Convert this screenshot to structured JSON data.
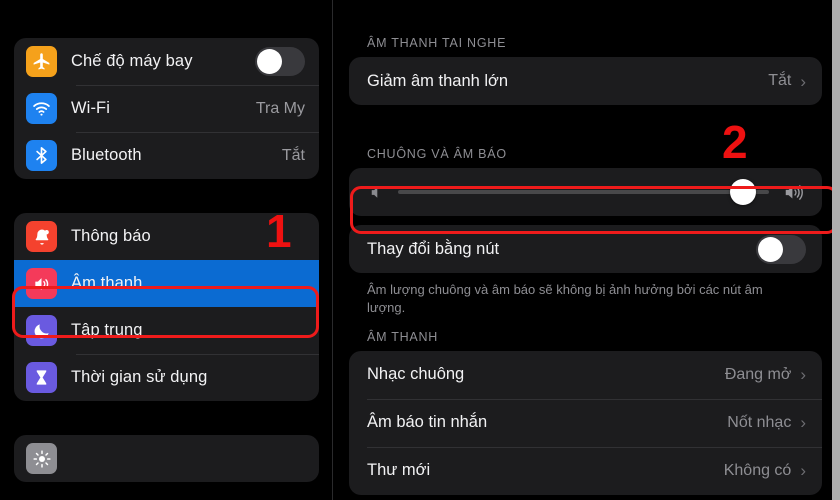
{
  "sidebar": {
    "group1": [
      {
        "label": "Chế độ máy bay",
        "icon": "airplane-icon",
        "icon_color": "#f5a11b",
        "control": "toggle",
        "toggle_on": false
      },
      {
        "label": "Wi-Fi",
        "icon": "wifi-icon",
        "icon_color": "#1e82f0",
        "control": "value",
        "value": "Tra My"
      },
      {
        "label": "Bluetooth",
        "icon": "bluetooth-icon",
        "icon_color": "#1e82f0",
        "control": "value",
        "value": "Tắt"
      }
    ],
    "group2": [
      {
        "label": "Thông báo",
        "icon": "bell-icon",
        "icon_color": "#f4422e",
        "selected": false
      },
      {
        "label": "Âm thanh",
        "icon": "speaker-icon",
        "icon_color": "#f43a5a",
        "selected": true
      },
      {
        "label": "Tập trung",
        "icon": "moon-icon",
        "icon_color": "#6a5ae0",
        "selected": false
      },
      {
        "label": "Thời gian sử dụng",
        "icon": "hourglass-icon",
        "icon_color": "#6a5ae0",
        "selected": false
      }
    ],
    "group3": [
      {
        "label": "",
        "icon": "brightness-icon",
        "icon_color": "#8e8e93"
      }
    ]
  },
  "detail": {
    "section_headphone": {
      "header": "ÂM THANH TAI NGHE",
      "rows": [
        {
          "label": "Giảm âm thanh lớn",
          "value": "Tắt"
        }
      ]
    },
    "section_ringer": {
      "header": "CHUÔNG VÀ ÂM BÁO",
      "slider": {
        "name": "ringer-volume-slider",
        "percent": 93,
        "left_icon": "speaker-low-icon",
        "right_icon": "speaker-high-icon"
      },
      "toggle_row": {
        "label": "Thay đổi bằng nút",
        "toggle_on": false
      },
      "footnote": "Âm lượng chuông và âm báo sẽ không bị ảnh hưởng bởi các nút âm lượng."
    },
    "section_sounds": {
      "header": "ÂM THANH",
      "rows": [
        {
          "label": "Nhạc chuông",
          "value": "Đang mở"
        },
        {
          "label": "Âm báo tin nhắn",
          "value": "Nốt nhạc"
        },
        {
          "label": "Thư mới",
          "value": "Không có"
        }
      ]
    }
  },
  "annotations": {
    "marker_one": "1",
    "marker_two": "2",
    "color": "#ee1111"
  },
  "colors": {
    "accent_blue": "#0b6bd2",
    "slider_blue": "#1a7ef0",
    "card_bg": "#1c1c1e",
    "page_bg": "#000000",
    "annotation_red": "#ee1b1b"
  }
}
